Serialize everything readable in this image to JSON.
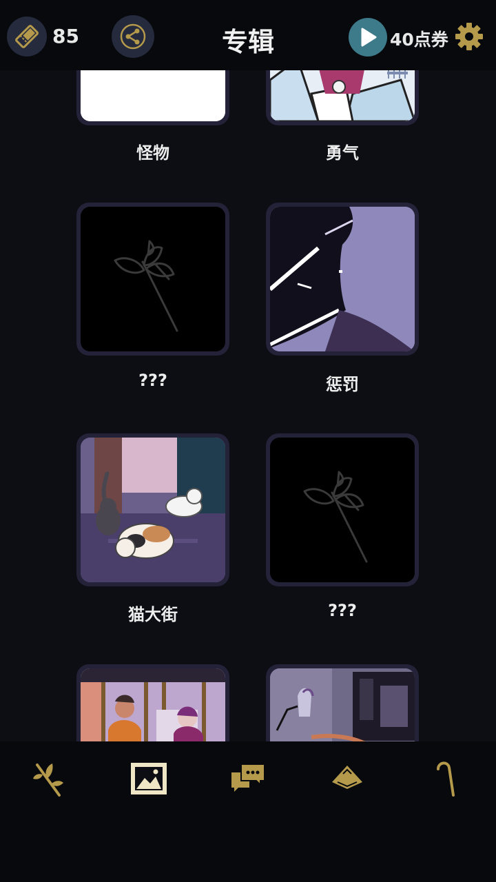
{
  "header": {
    "ticket_count": "85",
    "title": "专辑",
    "points_label": "40点券"
  },
  "albums": [
    {
      "label": "怪物",
      "locked": false
    },
    {
      "label": "勇气",
      "locked": false
    },
    {
      "label": "???",
      "locked": true
    },
    {
      "label": "惩罚",
      "locked": false
    },
    {
      "label": "猫大街",
      "locked": false
    },
    {
      "label": "???",
      "locked": true
    },
    {
      "label": "",
      "locked": false
    },
    {
      "label": "",
      "locked": false
    }
  ],
  "nav": {
    "items": [
      "branch-icon",
      "gallery-icon",
      "chat-icon",
      "hat-icon",
      "cane-icon"
    ],
    "active": "gallery-icon"
  },
  "colors": {
    "accent_gold": "#b59a4b",
    "header_bg": "#07090d",
    "page_bg": "#0c0e14",
    "card_frame": "#242238",
    "play_teal": "#3d7a8a"
  }
}
